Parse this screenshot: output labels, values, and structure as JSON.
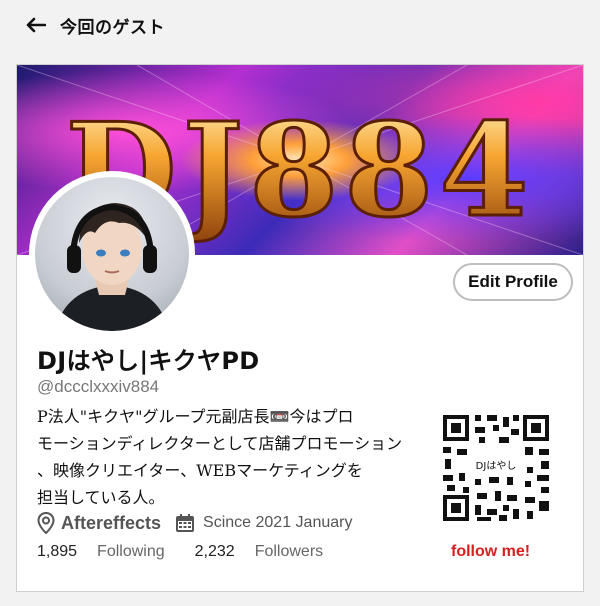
{
  "header": {
    "back_icon": "arrow-left-icon",
    "title": "今回のゲスト"
  },
  "banner": {
    "text": "DJ884"
  },
  "profile": {
    "edit_label": "Edit Profile",
    "name": "DJはやし|キクヤPD",
    "handle": "@dccclxxxiv884",
    "bio": "P法人\"キクヤ\"グループ元副店長📼今はプロ\nモーションディレクターとして店舗プロモーション\n、映像クリエイター、WEBマーケティングを\n担当している人。",
    "location_icon": "location-pin-icon",
    "location": "Aftereffects",
    "calendar_icon": "calendar-icon",
    "since": "Scince 2021 January",
    "stats": {
      "following_count": "1,895",
      "following_label": "Following",
      "followers_count": "2,232",
      "followers_label": "Followers"
    }
  },
  "qr": {
    "center_label": "DJはやし",
    "cta": "follow me!"
  },
  "colors": {
    "accent": "#d81e1e",
    "border": "#cfcfcf",
    "muted": "#777777"
  }
}
